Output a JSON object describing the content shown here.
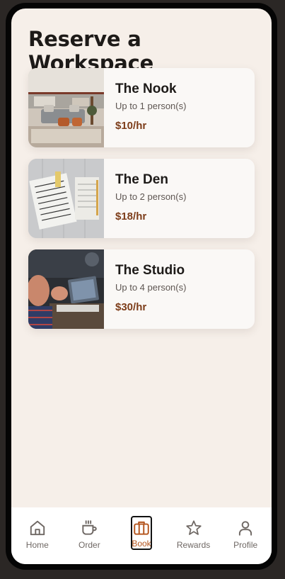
{
  "page": {
    "title": "Reserve a Workspace"
  },
  "workspaces": [
    {
      "name": "The Nook",
      "capacity": "Up to 1 person(s)",
      "price": "$10/hr",
      "image": "lounge-photo"
    },
    {
      "name": "The Den",
      "capacity": "Up to 2 person(s)",
      "price": "$18/hr",
      "image": "notes-photo"
    },
    {
      "name": "The Studio",
      "capacity": "Up to 4 person(s)",
      "price": "$30/hr",
      "image": "meeting-photo"
    }
  ],
  "nav": {
    "items": [
      {
        "label": "Home",
        "icon": "home-icon",
        "active": false
      },
      {
        "label": "Order",
        "icon": "coffee-cup-icon",
        "active": false
      },
      {
        "label": "Book",
        "icon": "briefcase-icon",
        "active": true
      },
      {
        "label": "Rewards",
        "icon": "star-icon",
        "active": false
      },
      {
        "label": "Profile",
        "icon": "person-icon",
        "active": false
      }
    ]
  },
  "colors": {
    "background": "#f6efe9",
    "accent": "#b4561f",
    "price": "#7d3d1a",
    "text": "#1d1a18"
  }
}
